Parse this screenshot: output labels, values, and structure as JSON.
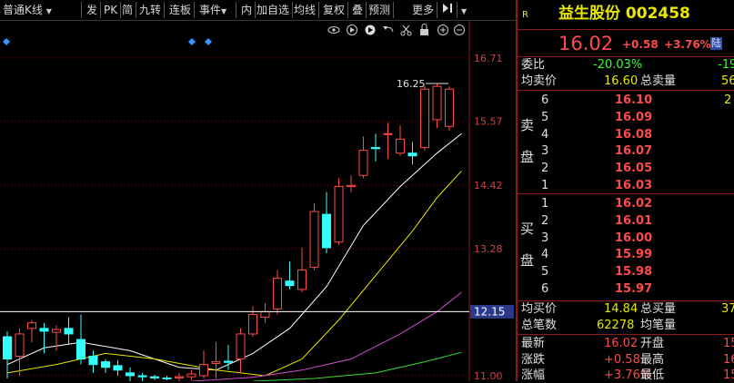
{
  "toolbar": {
    "items": [
      "普通K线",
      "发",
      "PK",
      "简",
      "九转",
      "连板",
      "事件",
      "内",
      "加自选",
      "均线",
      "复权",
      "叠",
      "预测",
      "更多"
    ]
  },
  "icons": [
    "eye-icon",
    "replay-icon",
    "play-icon",
    "undo-icon",
    "scissors-icon",
    "lock-icon",
    "zoom-in-icon",
    "zoom-out-icon"
  ],
  "chart_data": {
    "type": "candlestick",
    "y_ticks": [
      "16.71",
      "15.57",
      "14.42",
      "13.28",
      "12.15",
      "11.00"
    ],
    "ylim": [
      10.95,
      17.05
    ],
    "current_price_label": "12.15",
    "high_annotation": "16.25",
    "candles": [
      {
        "o": 11.7,
        "c": 11.3,
        "h": 11.8,
        "l": 10.95
      },
      {
        "o": 11.35,
        "c": 11.75,
        "h": 11.85,
        "l": 11.0
      },
      {
        "o": 11.85,
        "c": 11.95,
        "h": 12.0,
        "l": 11.6
      },
      {
        "o": 11.85,
        "c": 11.8,
        "h": 11.95,
        "l": 11.4
      },
      {
        "o": 11.78,
        "c": 11.83,
        "h": 11.9,
        "l": 11.45
      },
      {
        "o": 11.85,
        "c": 11.75,
        "h": 12.05,
        "l": 11.55
      },
      {
        "o": 11.65,
        "c": 11.3,
        "h": 12.1,
        "l": 11.2
      },
      {
        "o": 11.35,
        "c": 11.2,
        "h": 11.45,
        "l": 11.05
      },
      {
        "o": 11.25,
        "c": 11.15,
        "h": 11.3,
        "l": 11.05
      },
      {
        "o": 11.18,
        "c": 11.1,
        "h": 11.28,
        "l": 11.0
      },
      {
        "o": 11.05,
        "c": 11.0,
        "h": 11.15,
        "l": 10.9
      },
      {
        "o": 11.0,
        "c": 10.98,
        "h": 11.05,
        "l": 10.9
      },
      {
        "o": 10.98,
        "c": 10.96,
        "h": 11.02,
        "l": 10.92
      },
      {
        "o": 10.96,
        "c": 10.95,
        "h": 11.0,
        "l": 10.92
      },
      {
        "o": 10.96,
        "c": 10.98,
        "h": 11.05,
        "l": 10.9
      },
      {
        "o": 10.98,
        "c": 11.03,
        "h": 11.1,
        "l": 10.92
      },
      {
        "o": 11.0,
        "c": 11.2,
        "h": 11.45,
        "l": 10.95
      },
      {
        "o": 11.22,
        "c": 11.25,
        "h": 11.6,
        "l": 10.95
      },
      {
        "o": 11.26,
        "c": 11.24,
        "h": 11.55,
        "l": 11.1
      },
      {
        "o": 11.3,
        "c": 11.75,
        "h": 11.85,
        "l": 11.05
      },
      {
        "o": 11.75,
        "c": 12.1,
        "h": 12.25,
        "l": 11.7
      },
      {
        "o": 12.05,
        "c": 12.15,
        "h": 12.3,
        "l": 11.95
      },
      {
        "o": 12.2,
        "c": 12.75,
        "h": 12.9,
        "l": 12.1
      },
      {
        "o": 12.7,
        "c": 12.62,
        "h": 13.05,
        "l": 12.55
      },
      {
        "o": 12.55,
        "c": 12.9,
        "h": 13.3,
        "l": 12.5
      },
      {
        "o": 12.95,
        "c": 13.95,
        "h": 14.1,
        "l": 12.9
      },
      {
        "o": 13.9,
        "c": 13.3,
        "h": 14.3,
        "l": 13.2
      },
      {
        "o": 13.4,
        "c": 14.4,
        "h": 14.55,
        "l": 13.35
      },
      {
        "o": 14.4,
        "c": 14.42,
        "h": 14.6,
        "l": 14.3
      },
      {
        "o": 14.6,
        "c": 15.05,
        "h": 15.3,
        "l": 14.55
      },
      {
        "o": 15.1,
        "c": 15.08,
        "h": 15.35,
        "l": 14.85
      },
      {
        "o": 15.35,
        "c": 15.35,
        "h": 15.55,
        "l": 14.9
      },
      {
        "o": 15.0,
        "c": 15.25,
        "h": 15.5,
        "l": 14.95
      },
      {
        "o": 15.0,
        "c": 14.95,
        "h": 15.2,
        "l": 14.8
      },
      {
        "o": 15.1,
        "c": 16.15,
        "h": 16.2,
        "l": 15.05
      },
      {
        "o": 15.6,
        "c": 16.2,
        "h": 16.25,
        "l": 15.45
      },
      {
        "o": 15.48,
        "c": 16.15,
        "h": 16.2,
        "l": 15.4
      }
    ],
    "ma_lines": [
      {
        "color": "#ffffff",
        "points": [
          [
            0,
            11.2
          ],
          [
            3,
            11.5
          ],
          [
            6,
            11.6
          ],
          [
            10,
            11.45
          ],
          [
            14,
            11.15
          ],
          [
            17,
            11.1
          ],
          [
            20,
            11.4
          ],
          [
            23,
            11.85
          ],
          [
            26,
            12.6
          ],
          [
            29,
            13.7
          ],
          [
            32,
            14.4
          ],
          [
            35,
            15.0
          ],
          [
            37,
            15.35
          ]
        ]
      },
      {
        "color": "#e8e800",
        "points": [
          [
            0,
            11.05
          ],
          [
            4,
            11.2
          ],
          [
            8,
            11.4
          ],
          [
            12,
            11.3
          ],
          [
            17,
            11.1
          ],
          [
            21,
            11.0
          ],
          [
            24,
            11.3
          ],
          [
            27,
            12.0
          ],
          [
            30,
            12.8
          ],
          [
            33,
            13.6
          ],
          [
            35,
            14.2
          ],
          [
            37,
            14.68
          ]
        ]
      },
      {
        "color": "#d24cd2",
        "points": [
          [
            15,
            10.9
          ],
          [
            20,
            10.97
          ],
          [
            24,
            11.1
          ],
          [
            28,
            11.3
          ],
          [
            32,
            11.75
          ],
          [
            35,
            12.15
          ],
          [
            37,
            12.5
          ]
        ]
      },
      {
        "color": "#33dd33",
        "points": [
          [
            20,
            10.9
          ],
          [
            25,
            10.95
          ],
          [
            30,
            11.05
          ],
          [
            34,
            11.25
          ],
          [
            37,
            11.42
          ]
        ]
      }
    ]
  },
  "quote": {
    "badge": "R",
    "title": "益生股份 002458",
    "price": "16.02",
    "change": "+0.58",
    "change_pct": "+3.76%",
    "market_tag": "陆",
    "weibi_label": "委比",
    "weibi_value": "-20.03%",
    "weibi_diff": "-19",
    "avg_sell_label": "均卖价",
    "avg_sell_value": "16.60",
    "total_sell_label": "总卖量",
    "total_sell_value": "56",
    "sell_side_label": [
      "卖",
      "盘"
    ],
    "sells": [
      {
        "lvl": "6",
        "price": "16.10",
        "vol": "2"
      },
      {
        "lvl": "5",
        "price": "16.09",
        "vol": ""
      },
      {
        "lvl": "4",
        "price": "16.08",
        "vol": ""
      },
      {
        "lvl": "3",
        "price": "16.07",
        "vol": ""
      },
      {
        "lvl": "2",
        "price": "16.05",
        "vol": ""
      },
      {
        "lvl": "1",
        "price": "16.03",
        "vol": ""
      }
    ],
    "buy_side_label": [
      "买",
      "盘"
    ],
    "buys": [
      {
        "lvl": "1",
        "price": "16.02",
        "vol": ""
      },
      {
        "lvl": "2",
        "price": "16.01",
        "vol": ""
      },
      {
        "lvl": "3",
        "price": "16.00",
        "vol": ""
      },
      {
        "lvl": "4",
        "price": "15.99",
        "vol": ""
      },
      {
        "lvl": "5",
        "price": "15.98",
        "vol": ""
      },
      {
        "lvl": "6",
        "price": "15.97",
        "vol": ""
      }
    ],
    "avg_buy_label": "均买价",
    "avg_buy_value": "14.84",
    "total_buy_label": "总买量",
    "total_buy_value": "37",
    "total_deals_label": "总笔数",
    "total_deals_value": "62278",
    "avg_lot_label": "均笔量",
    "stats": [
      {
        "label": "最新",
        "value": "16.02",
        "label2": "开盘",
        "value2": "15"
      },
      {
        "label": "涨跌",
        "value": "+0.58",
        "label2": "最高",
        "value2": "16"
      },
      {
        "label": "涨幅",
        "value": "+3.76%",
        "label2": "最低",
        "value2": "15"
      }
    ]
  },
  "colors": {
    "up": "#ff4a4a",
    "down": "#33ffff",
    "grid": "#6a1010",
    "axis": "#8a1a1a"
  }
}
